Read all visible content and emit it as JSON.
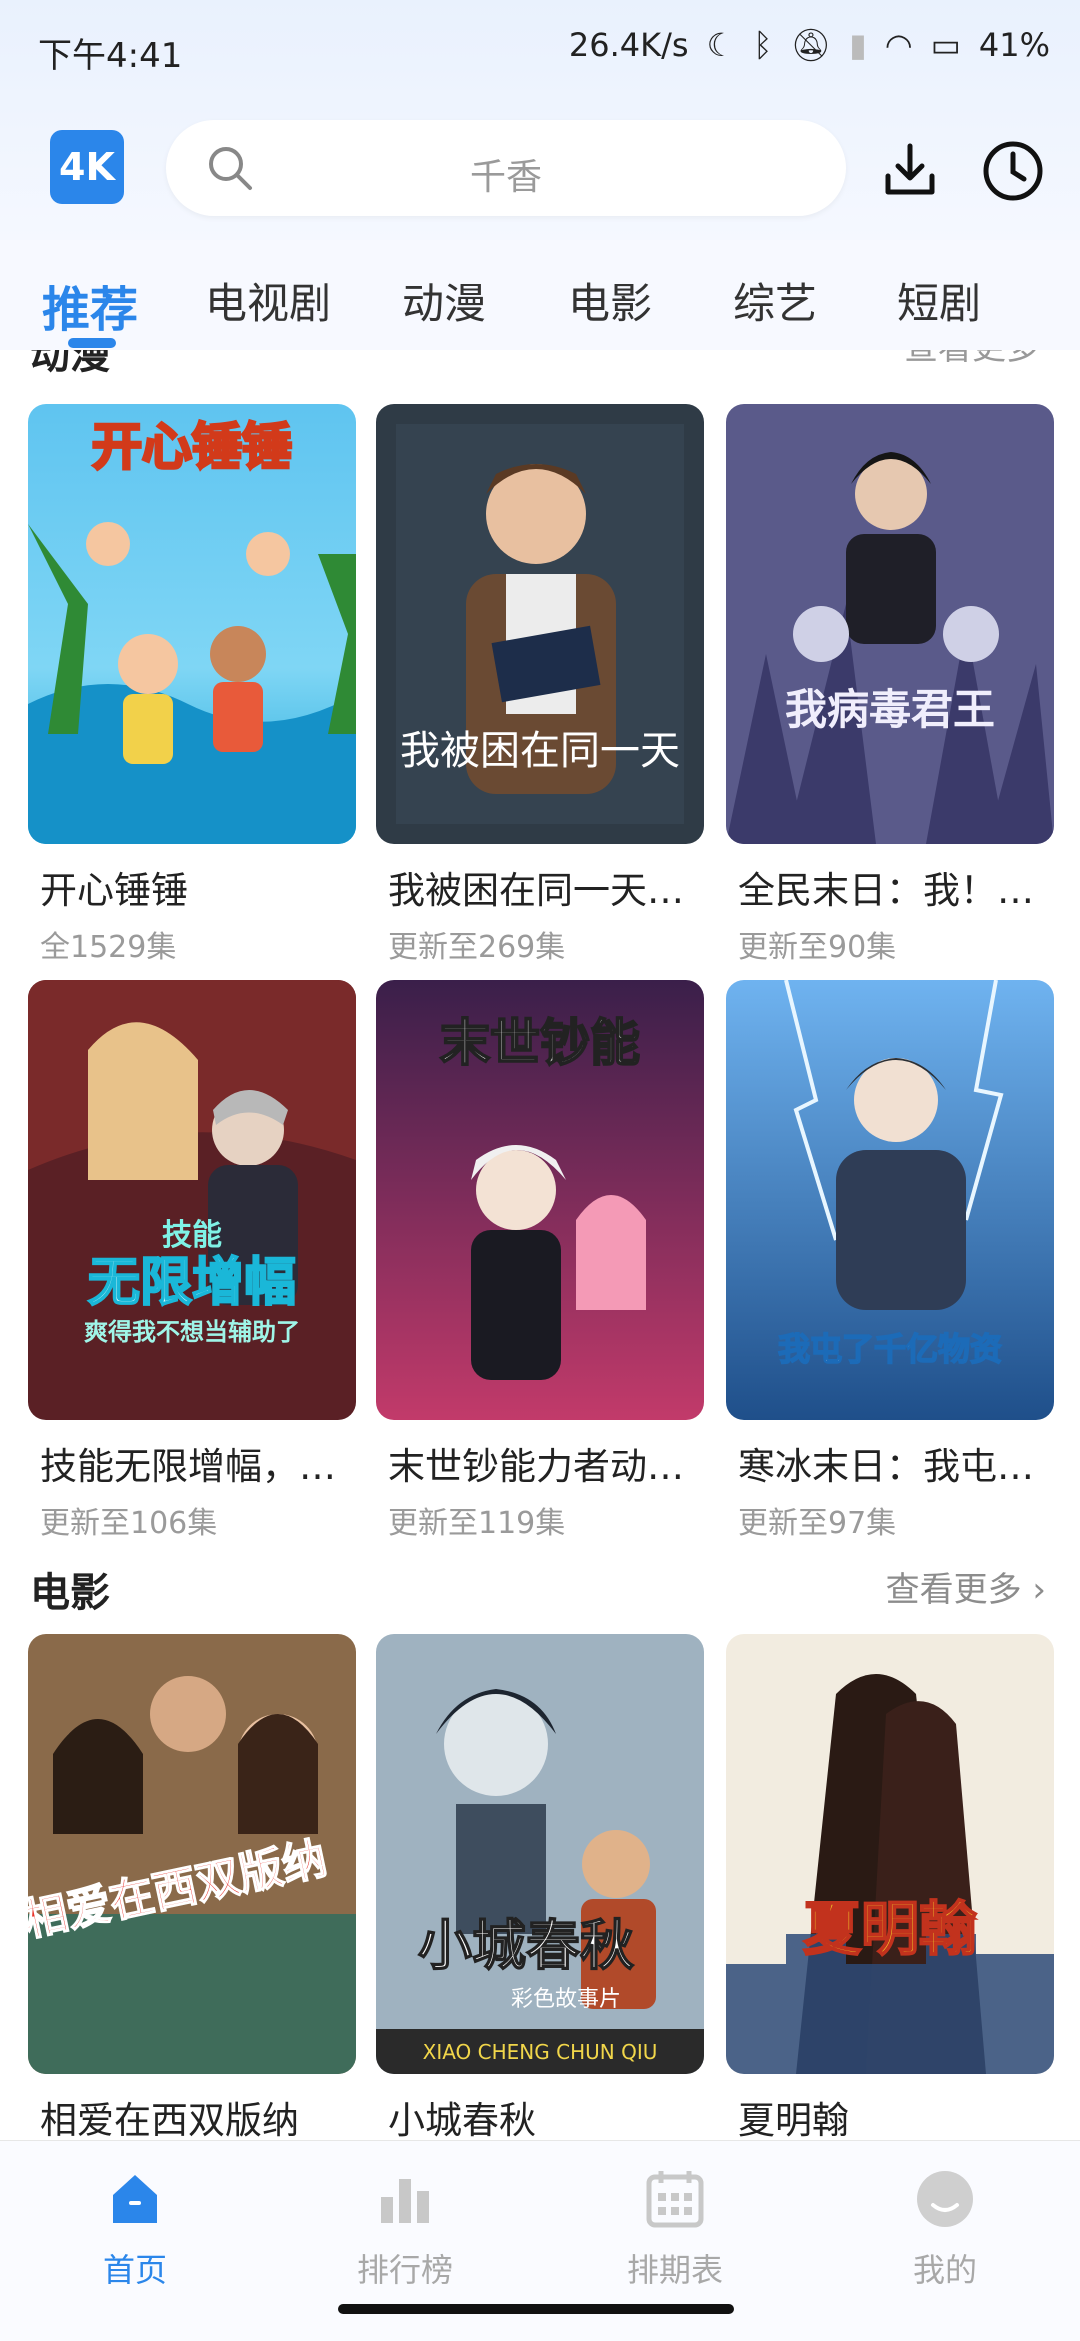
{
  "status": {
    "time": "下午4:41",
    "net_speed": "26.4K/s",
    "battery": "41%"
  },
  "header": {
    "logo": "4K",
    "search_placeholder": "千香"
  },
  "tabs": [
    "推荐",
    "电视剧",
    "动漫",
    "电影",
    "综艺",
    "短剧"
  ],
  "sections": {
    "anime_partial_title": "动漫",
    "anime_partial_more": "查看更多",
    "movie": {
      "title": "电影",
      "more": "查看更多 ›"
    }
  },
  "anime_cards": [
    {
      "title": "开心锤锤",
      "sub": "全1529集"
    },
    {
      "title": "我被困在同一天…",
      "sub": "更新至269集"
    },
    {
      "title": "全民末日：我！…",
      "sub": "更新至90集"
    },
    {
      "title": "技能无限增幅，…",
      "sub": "更新至106集"
    },
    {
      "title": "末世钞能力者动…",
      "sub": "更新至119集"
    },
    {
      "title": "寒冰末日：我屯…",
      "sub": "更新至97集"
    }
  ],
  "movie_cards": [
    {
      "title": "相爱在西双版纳"
    },
    {
      "title": "小城春秋"
    },
    {
      "title": "夏明翰"
    }
  ],
  "posters": {
    "p1_text": "开心锤锤",
    "p2_text": "我被困在同一天",
    "p3_text": "我病毒君王",
    "p4_text_a": "技能",
    "p4_text_b": "无限增幅",
    "p4_text_c": "爽得我不想当辅助了",
    "p5_text": "末世钞能",
    "p6_text": "我屯了千亿物资",
    "m1_text": "相爱在西双版纳",
    "m2_text": "小城春秋",
    "m2_sub": "彩色故事片",
    "m2_pinyin": "XIAO CHENG CHUN QIU",
    "m3_text": "夏明翰"
  },
  "bottom_nav": [
    "首页",
    "排行榜",
    "排期表",
    "我的"
  ],
  "colors": {
    "accent": "#2b86ea"
  }
}
